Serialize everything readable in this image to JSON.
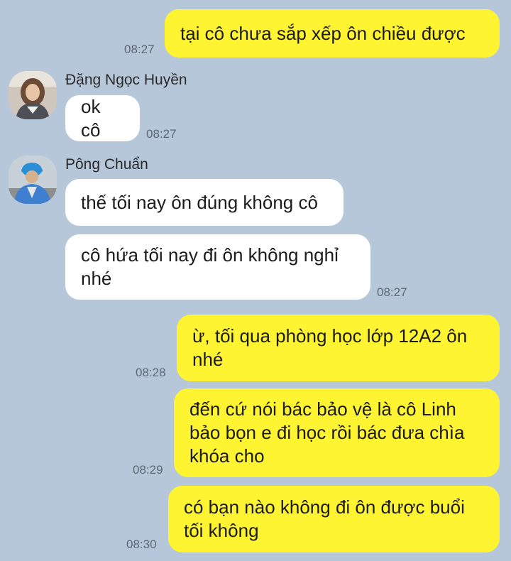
{
  "messages": [
    {
      "id": "m1",
      "direction": "out",
      "text": "tại cô chưa sắp xếp ôn chiều được",
      "time": "08:27"
    },
    {
      "id": "m2",
      "direction": "in",
      "sender": "Đặng Ngọc Huyền",
      "text": "ok cô",
      "time": "08:27"
    },
    {
      "id": "m3",
      "direction": "in",
      "sender": "Pông Chuẩn",
      "text": "thế tối nay ôn đúng không cô",
      "time": ""
    },
    {
      "id": "m4",
      "direction": "in",
      "sender": "",
      "text": "cô hứa tối nay đi ôn không nghỉ\nnhé",
      "time": "08:27"
    },
    {
      "id": "m5",
      "direction": "out",
      "text": "ừ, tối qua phòng học lớp 12A2 ôn\nnhé",
      "time": "08:28"
    },
    {
      "id": "m6",
      "direction": "out",
      "text": "đến cứ nói bác bảo vệ là cô Linh\nbảo bọn e đi học rồi bác đưa chìa\nkhóa cho",
      "time": "08:29"
    },
    {
      "id": "m7",
      "direction": "out",
      "text": "có bạn nào không đi ôn được buổi\ntối không",
      "time": "08:30"
    }
  ],
  "colors": {
    "background": "#b7c7da",
    "outgoing_bubble": "#fff431",
    "incoming_bubble": "#ffffff",
    "timestamp": "#5d6673"
  }
}
